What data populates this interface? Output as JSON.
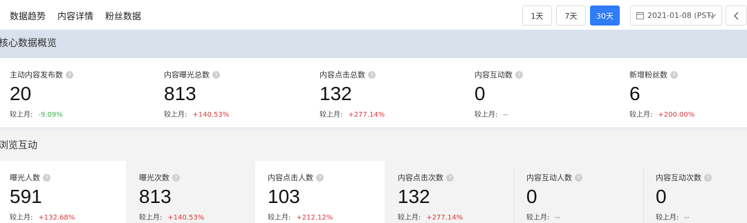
{
  "tabs": [
    "数据趋势",
    "内容详情",
    "粉丝数据"
  ],
  "range_buttons": [
    {
      "label": "1天",
      "active": false
    },
    {
      "label": "7天",
      "active": false
    },
    {
      "label": "30天",
      "active": true
    }
  ],
  "date": "2021-01-08 (PST)",
  "colors": {
    "accent": "#2f7cf6",
    "up": "#d9363e",
    "down": "#3fb24b",
    "header_bg": "#d9e1ec"
  },
  "icons": {
    "calendar": "calendar-icon",
    "chevron": "chevron-down-icon",
    "back": "chevron-left-icon",
    "help": "question-circle-icon"
  },
  "overview": {
    "title": "核心数据概览",
    "compare_prefix": "较上月:",
    "metrics": [
      {
        "label": "主动内容发布数",
        "value": "20",
        "change": "-9.09%"
      },
      {
        "label": "内容曝光总数",
        "value": "813",
        "change": "+140.53%"
      },
      {
        "label": "内容点击总数",
        "value": "132",
        "change": "+277.14%"
      },
      {
        "label": "内容互动数",
        "value": "0",
        "change": "--"
      },
      {
        "label": "新增粉丝数",
        "value": "6",
        "change": "+200.00%"
      }
    ]
  },
  "interaction": {
    "title": "浏览互动",
    "compare_prefix": "较上月:",
    "metrics": [
      {
        "label": "曝光人数",
        "value": "591",
        "change": "+132.68%"
      },
      {
        "label": "曝光次数",
        "value": "813",
        "change": "+140.53%"
      },
      {
        "label": "内容点击人数",
        "value": "103",
        "change": "+212.12%"
      },
      {
        "label": "内容点击次数",
        "value": "132",
        "change": "+277.14%"
      },
      {
        "label": "内容互动人数",
        "value": "0",
        "change": "--"
      },
      {
        "label": "内容互动次数",
        "value": "0",
        "change": "--"
      }
    ]
  }
}
